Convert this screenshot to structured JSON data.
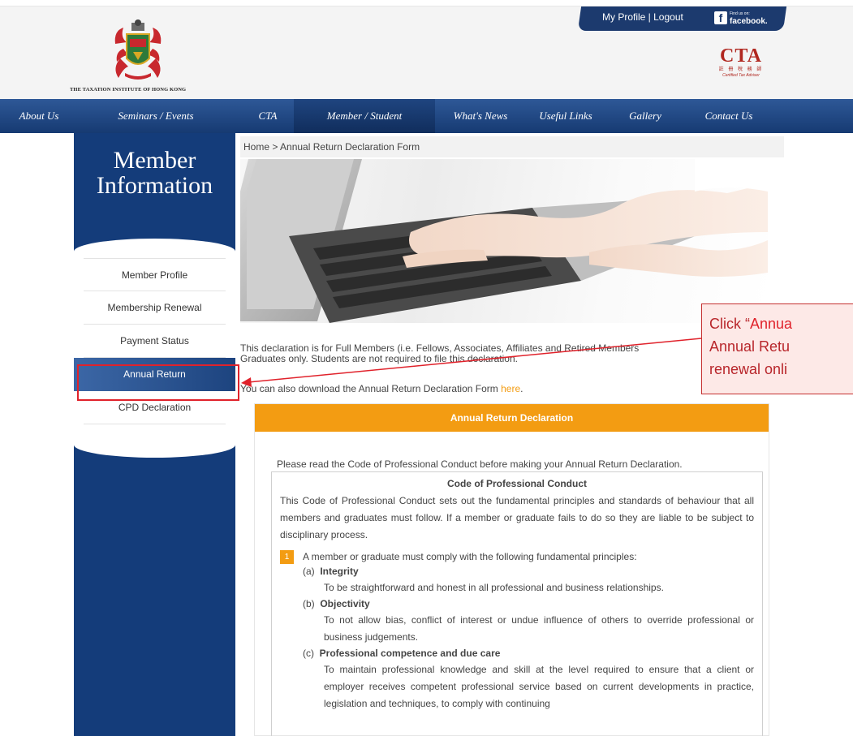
{
  "header": {
    "org_name": "THE TAXATION INSTITUTE OF HONG KONG",
    "profile_logout": "My Profile | Logout",
    "facebook_small": "Find us on:",
    "facebook_big": "facebook.",
    "facebook_glyph": "f",
    "cta_logo_word": "CTA",
    "cta_logo_cn": "註 冊 稅 務 師",
    "cta_logo_sub": "Certified Tax Adviser"
  },
  "nav": {
    "items": [
      "About Us",
      "Seminars / Events",
      "CTA",
      "Member / Student",
      "What's News",
      "Useful Links",
      "Gallery",
      "Contact Us"
    ],
    "active": "Member / Student"
  },
  "sidebar": {
    "title_line1": "Member",
    "title_line2": "Information",
    "items": [
      "Member Profile",
      "Membership Renewal",
      "Payment Status",
      "Annual Return",
      "CPD Declaration"
    ],
    "active": "Annual Return"
  },
  "breadcrumb": "Home > Annual Return Declaration Form",
  "intro": {
    "line1": "This declaration is for Full Members (i.e. Fellows, Associates, Affiliates and Retired Members",
    "line2": "Graduates only. Students are not required to file this declaration.",
    "download_prefix": "You can also download the Annual Return Declaration Form ",
    "download_link": "here",
    "download_suffix": "."
  },
  "callout": {
    "line1_prefix": "Click “",
    "line1_highlight": "Annua",
    "line2": "Annual Retu",
    "line3": "renewal onli"
  },
  "panel": {
    "heading": "Annual Return Declaration",
    "instruction": "Please read the Code of Professional Conduct before making your Annual Return Declaration.",
    "code_title": "Code of Professional Conduct",
    "code_para": "This Code of Professional Conduct sets out the fundamental principles and standards of behaviour that all members and graduates must follow. If a member or graduate fails to do so they are liable to be subject to disciplinary process.",
    "point_number": "1",
    "point_text": "A member or graduate must comply with the following fundamental principles:",
    "principles": [
      {
        "label": "(a)",
        "title": "Integrity",
        "desc": "To be straightforward and honest in all professional and business relationships."
      },
      {
        "label": "(b)",
        "title": "Objectivity",
        "desc": "To not allow bias, conflict of interest or undue influence of others to override professional or business judgements."
      },
      {
        "label": "(c)",
        "title": "Professional competence and due care",
        "desc": "To maintain professional knowledge and skill at the level required to ensure that a client or employer receives competent professional service based on current developments in practice, legislation and techniques, to comply with continuing"
      }
    ]
  },
  "colors": {
    "navy": "#143c7a",
    "orange": "#f39c12",
    "highlight_red": "#e0222b"
  }
}
